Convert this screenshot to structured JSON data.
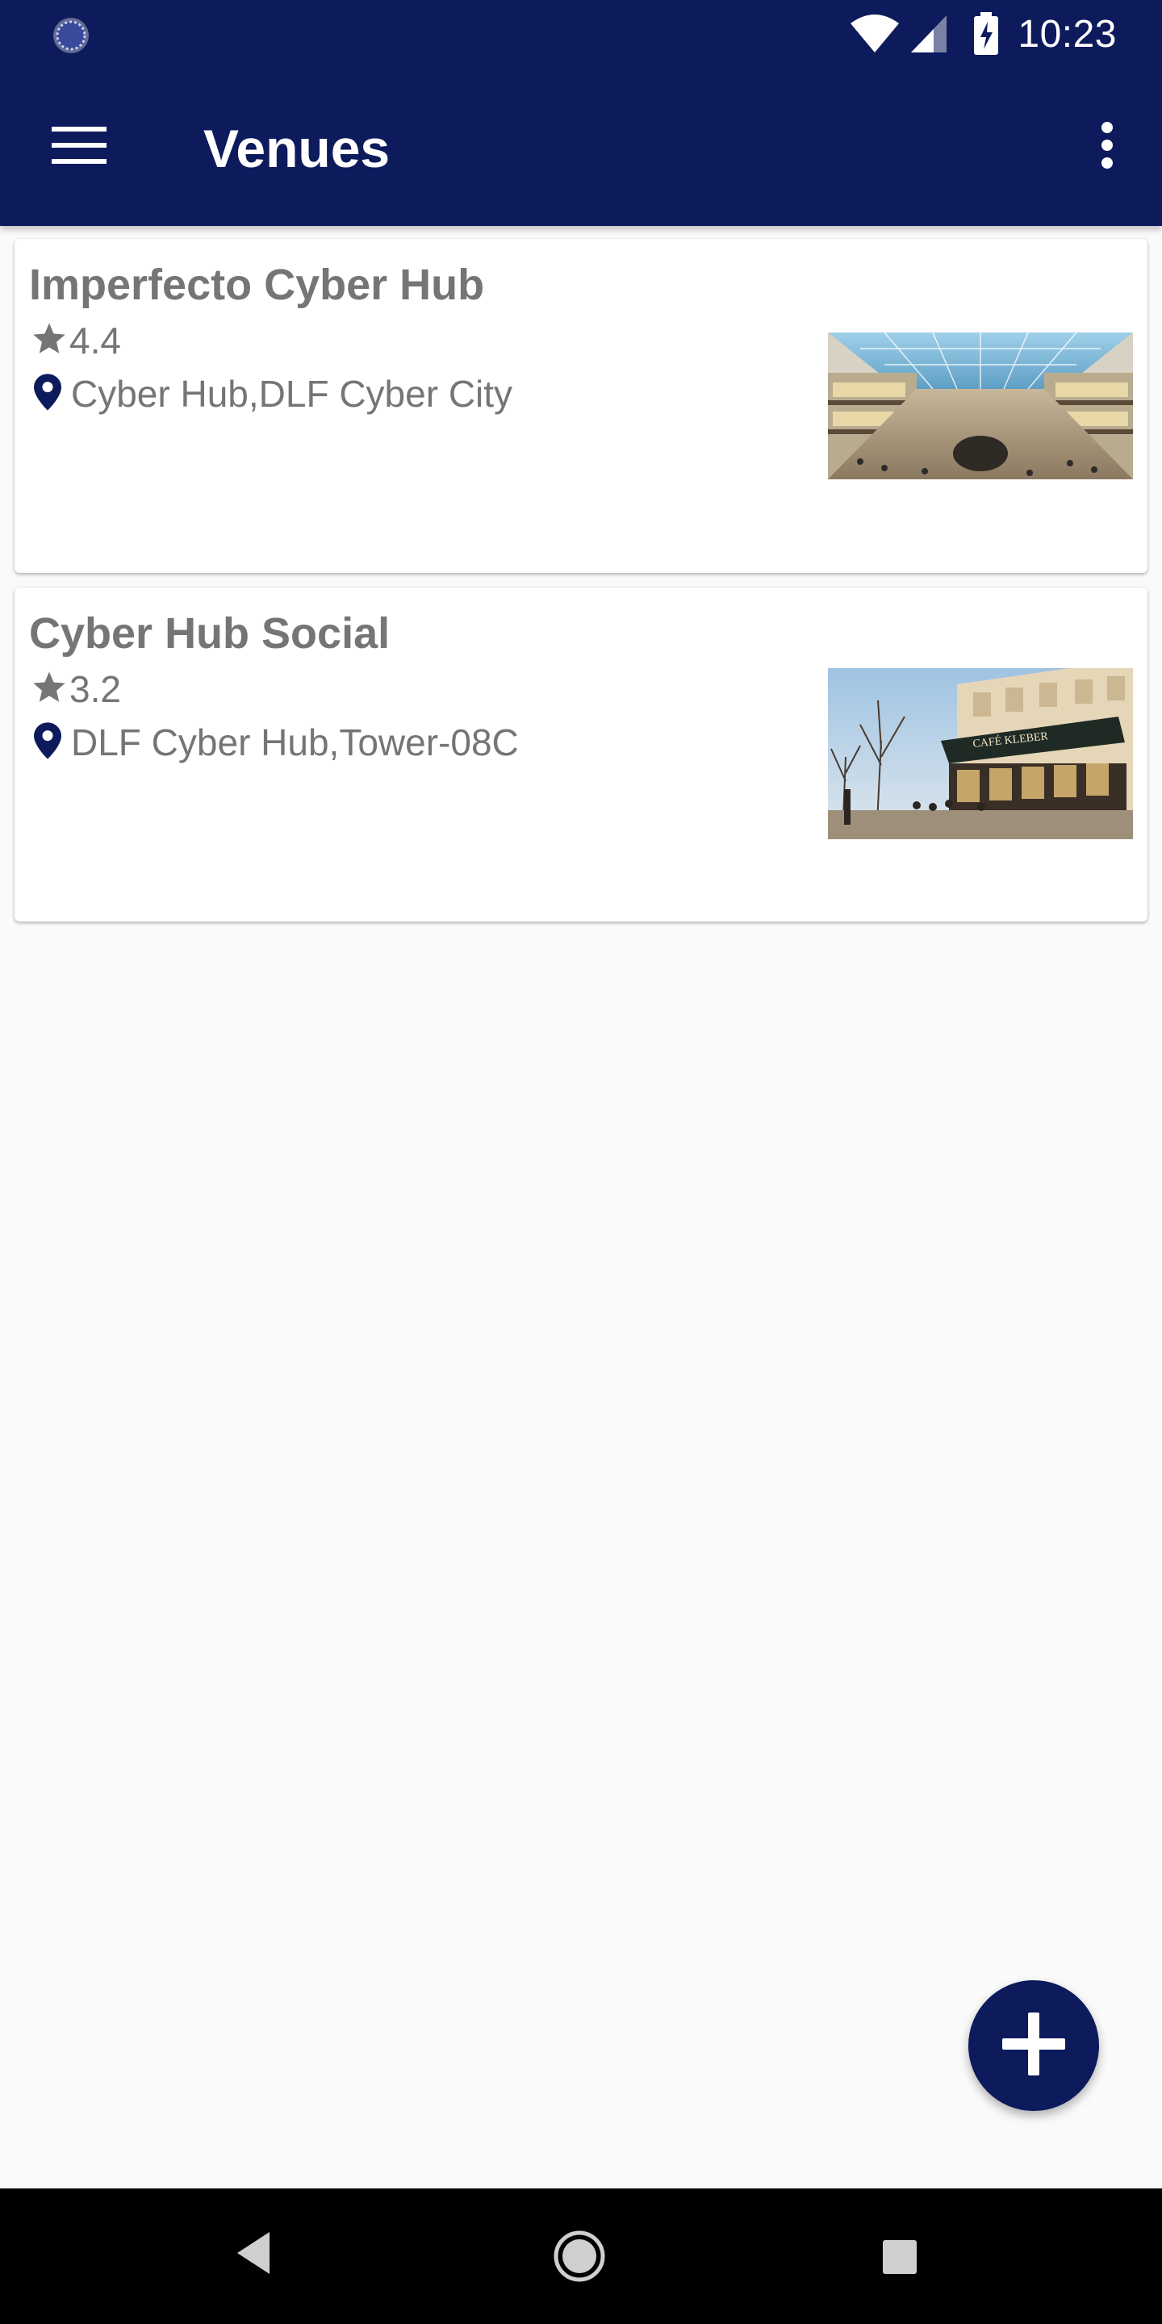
{
  "status_bar": {
    "time": "10:23",
    "icons": [
      "sync-icon",
      "wifi-icon",
      "signal-icon",
      "battery-charging-icon"
    ]
  },
  "app_bar": {
    "title": "Venues",
    "menu_icon": "hamburger-menu-icon",
    "overflow_icon": "more-vertical-icon"
  },
  "venues": [
    {
      "name": "Imperfecto Cyber Hub",
      "rating": "4.4",
      "location": "Cyber Hub,DLF Cyber City",
      "image": "shopping-mall-interior-photo"
    },
    {
      "name": "Cyber Hub Social",
      "rating": "3.2",
      "location": "DLF Cyber Hub,Tower-08C",
      "image": "street-cafe-photo"
    }
  ],
  "fab": {
    "icon": "plus-icon"
  },
  "nav_bar": {
    "icons": [
      "back-icon",
      "home-icon",
      "recents-icon"
    ]
  },
  "colors": {
    "primary": "#0d1a5c",
    "text_secondary": "#757575",
    "background": "#fafafa"
  }
}
